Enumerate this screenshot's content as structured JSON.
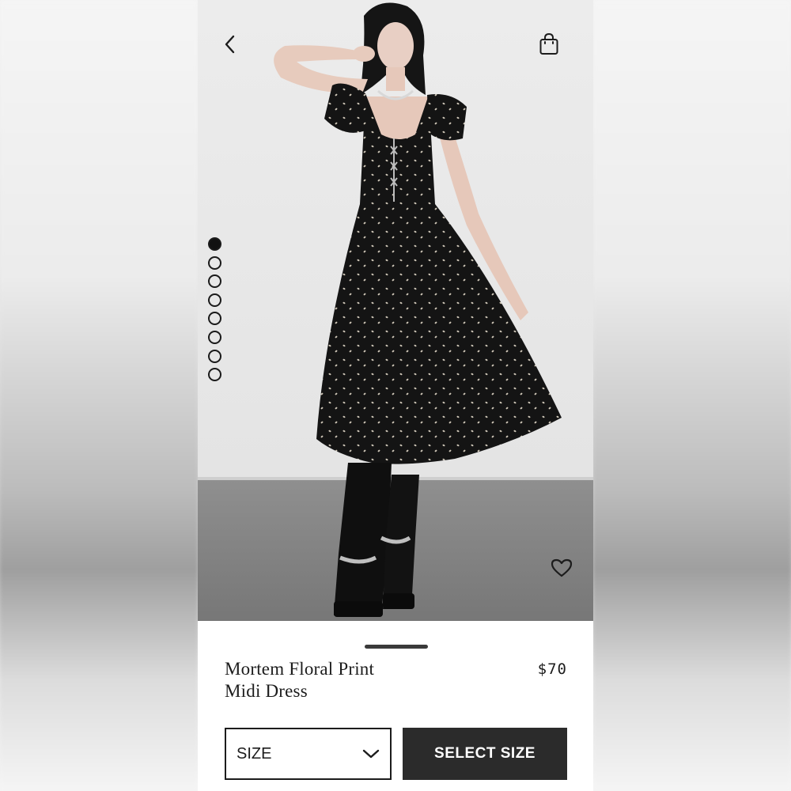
{
  "product": {
    "title_line1": "Mortem Floral Print",
    "title_line2": "Midi Dress",
    "price": "$70"
  },
  "gallery": {
    "image_count": 8,
    "active_index": 0
  },
  "actions": {
    "size_placeholder": "SIZE",
    "select_size_label": "SELECT SIZE"
  },
  "icons": {
    "back": "chevron-left-icon",
    "bag": "shopping-bag-icon",
    "favorite": "heart-outline-icon",
    "dropdown": "chevron-down-icon"
  },
  "colors": {
    "button_bg": "#2b2b2b",
    "text": "#1c1c1c"
  }
}
